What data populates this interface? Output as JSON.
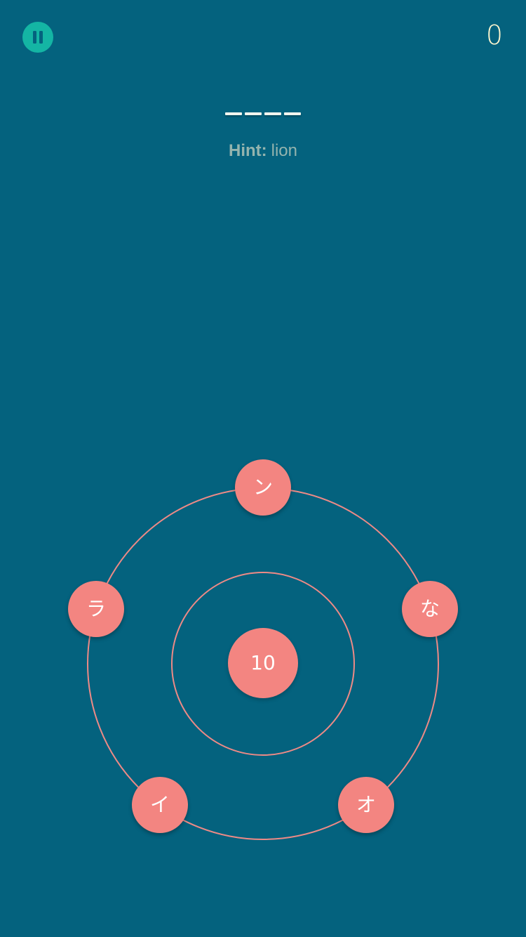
{
  "header": {
    "pause_icon": "pause-icon",
    "score": "0"
  },
  "puzzle": {
    "answer_length": 4,
    "hint_label": "Hint:",
    "hint_word": "lion"
  },
  "wheel": {
    "center_count": "10",
    "letters": [
      "ン",
      "な",
      "オ",
      "イ",
      "ラ"
    ]
  },
  "colors": {
    "background": "#04627e",
    "accent_pause": "#14b5a4",
    "letter_bubble": "#f38581",
    "orbit_line": "#ee8a86",
    "score_text": "#fff7cf",
    "hint_text": "#94b4ae"
  }
}
